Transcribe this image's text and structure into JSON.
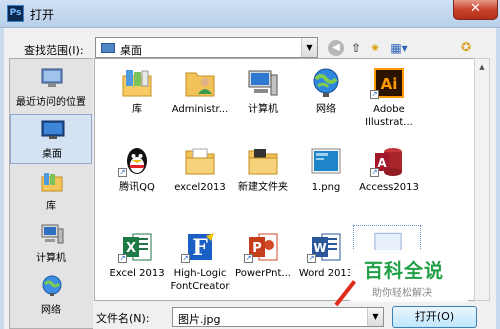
{
  "window": {
    "title": "打开",
    "app_icon": "Ps",
    "close": "✕"
  },
  "toolbar": {
    "lookin_label": "查找范围(I):",
    "lookin_value": "桌面"
  },
  "places": [
    {
      "label": "最近访问的位置",
      "icon": "recent-places-icon"
    },
    {
      "label": "桌面",
      "icon": "desktop-icon"
    },
    {
      "label": "库",
      "icon": "libraries-icon"
    },
    {
      "label": "计算机",
      "icon": "computer-icon"
    },
    {
      "label": "网络",
      "icon": "network-icon"
    }
  ],
  "files": [
    {
      "name": "库",
      "icon": "libraries-icon"
    },
    {
      "name": "Administr...",
      "icon": "user-folder-icon"
    },
    {
      "name": "计算机",
      "icon": "computer-icon"
    },
    {
      "name": "网络",
      "icon": "network-icon"
    },
    {
      "name": "Adobe Illustrat...",
      "icon": "illustrator-icon",
      "shortcut": true
    },
    {
      "name": "腾讯QQ",
      "icon": "qq-icon",
      "shortcut": true
    },
    {
      "name": "excel2013",
      "icon": "folder-icon"
    },
    {
      "name": "新建文件夹",
      "icon": "folder-icon"
    },
    {
      "name": "1.png",
      "icon": "image-file-icon"
    },
    {
      "name": "Access2013",
      "icon": "access-icon",
      "shortcut": true
    },
    {
      "name": "Excel 2013",
      "icon": "excel-icon",
      "shortcut": true
    },
    {
      "name": "High-Logic FontCreator",
      "icon": "fontcreator-icon",
      "shortcut": true
    },
    {
      "name": "PowerPnt...",
      "icon": "powerpoint-icon",
      "shortcut": true
    },
    {
      "name": "Word 2013",
      "icon": "word-icon",
      "shortcut": true
    },
    {
      "name": "",
      "icon": "image-file-icon"
    }
  ],
  "bottom": {
    "filename_label": "文件名(N):",
    "filename_value": "图片.jpg",
    "open_button": "打开(O)"
  },
  "watermark": {
    "title": "百科全说",
    "subtitle": "助你轻松解决"
  }
}
